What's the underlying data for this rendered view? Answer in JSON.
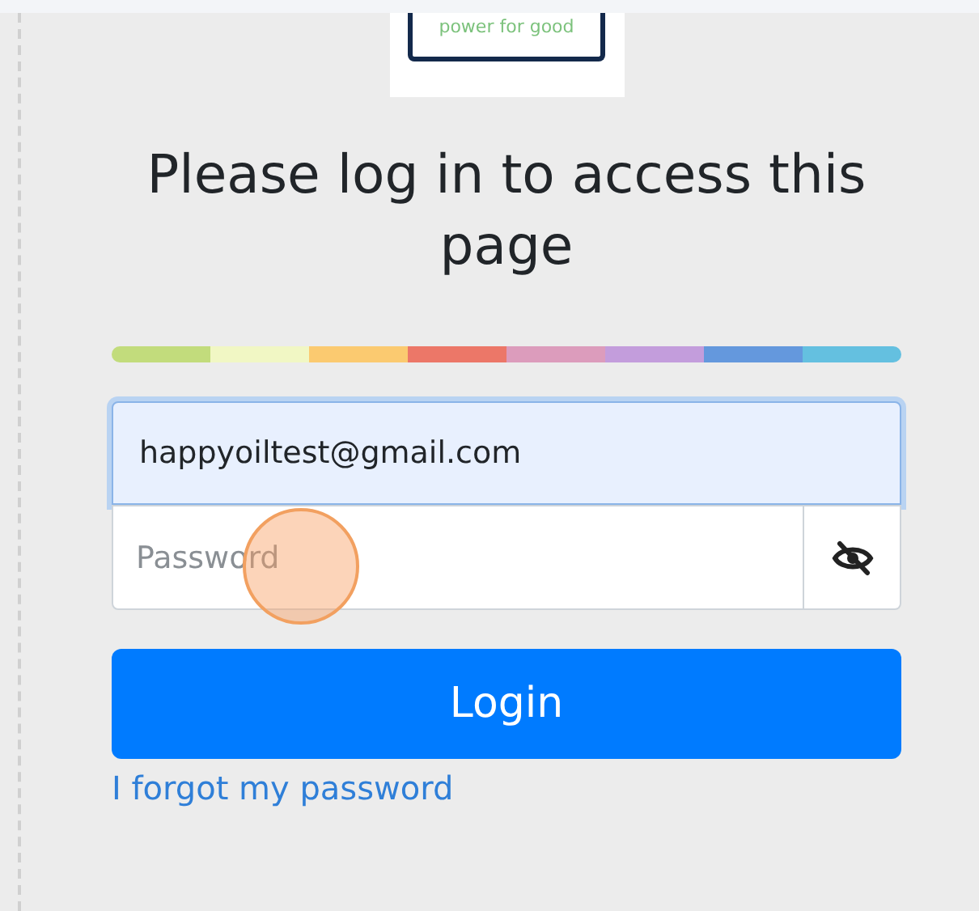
{
  "logo": {
    "tagline": "power for good"
  },
  "heading": "Please log in to access this page",
  "email_field": {
    "value": "happyoiltest@gmail.com"
  },
  "password_field": {
    "placeholder": "Password"
  },
  "login_button": {
    "label": "Login"
  },
  "forgot_link": {
    "label": "I forgot my password"
  }
}
